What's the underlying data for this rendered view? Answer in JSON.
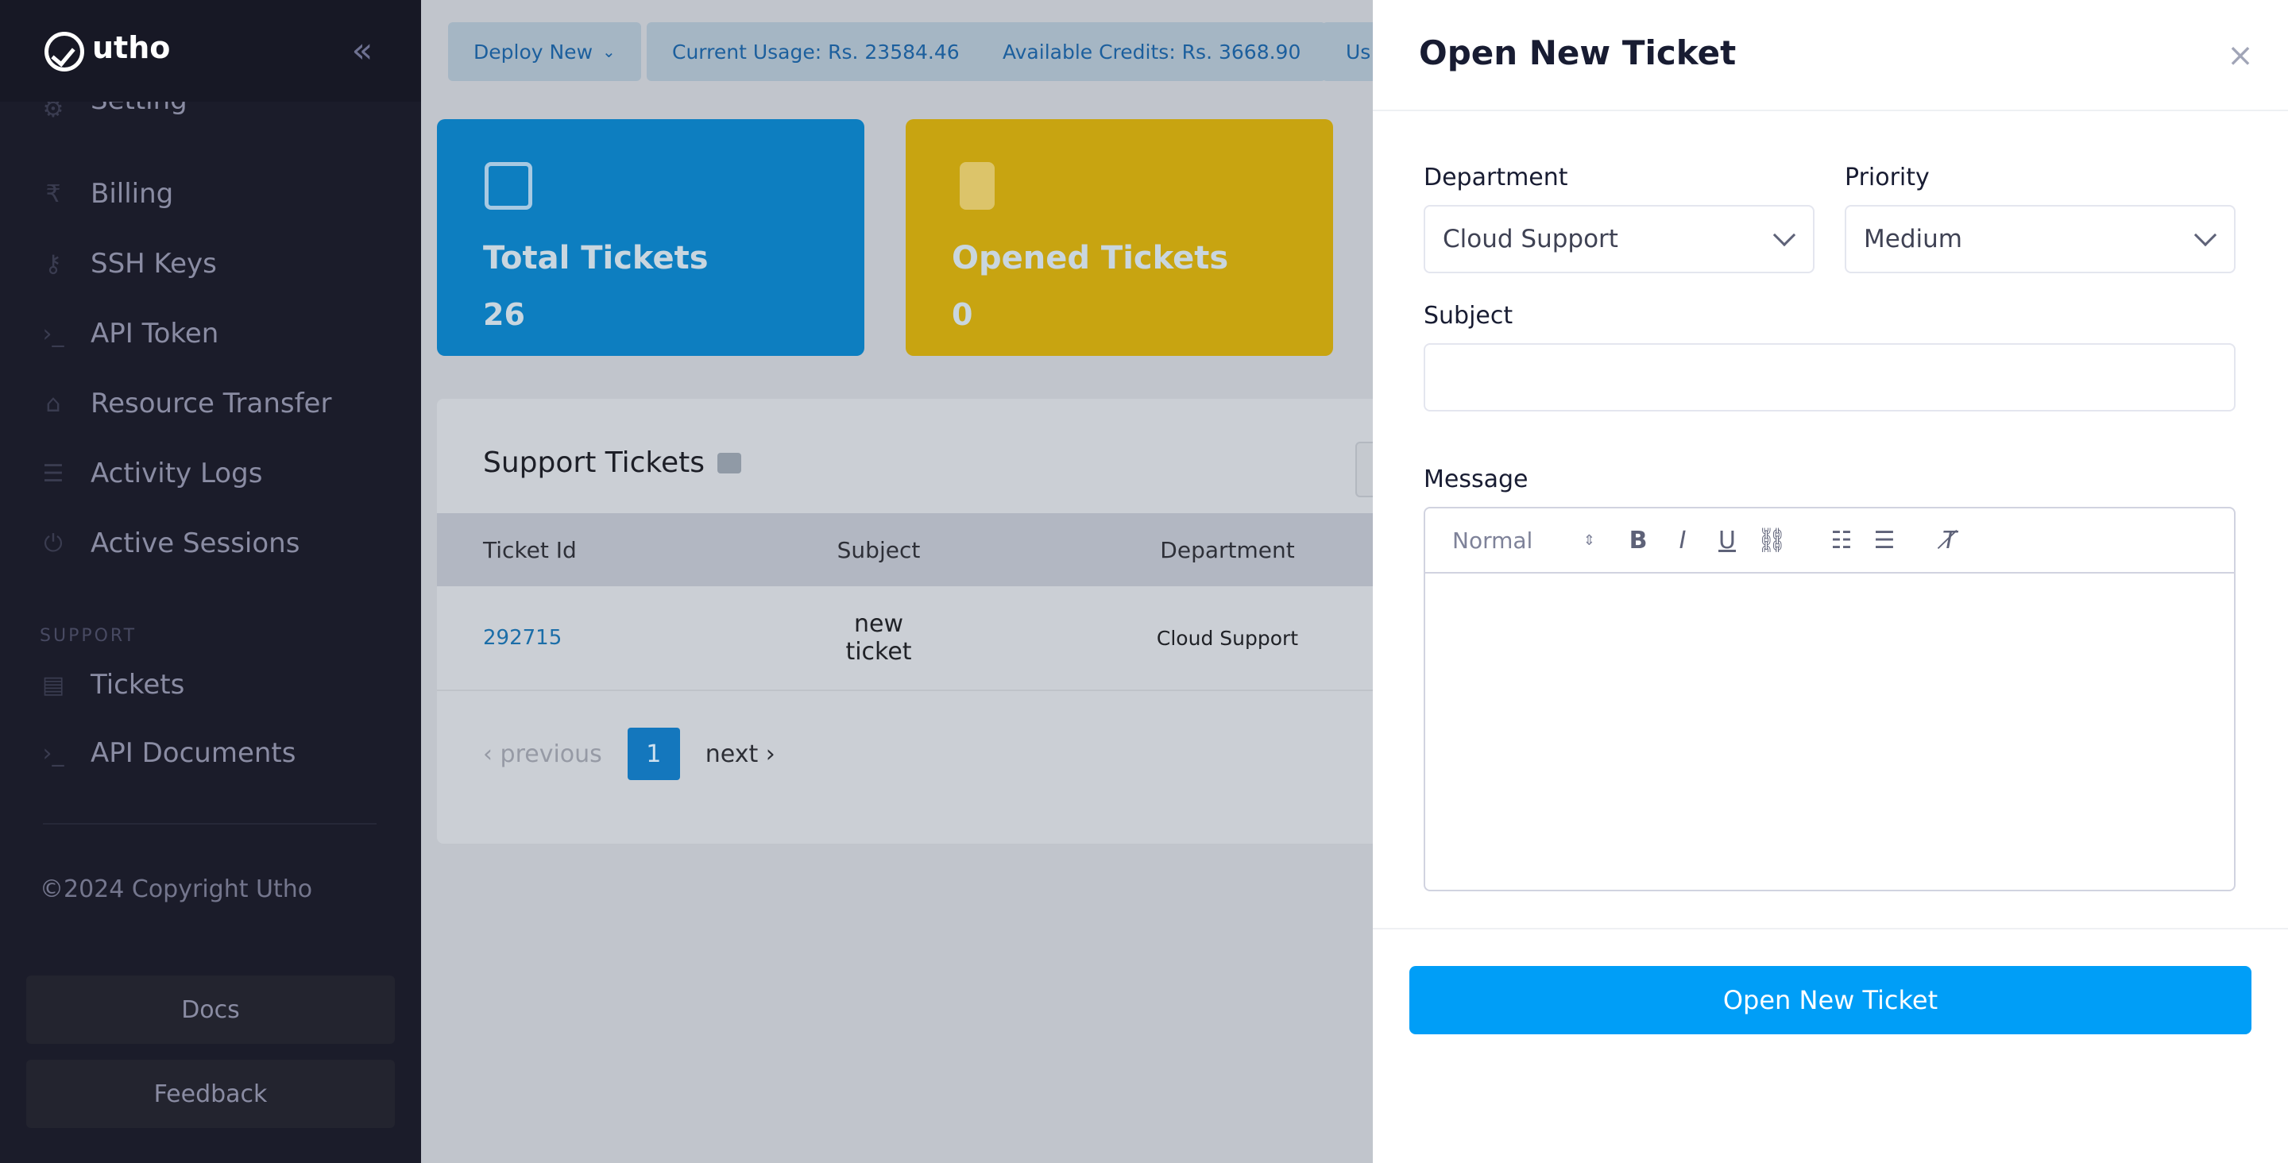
{
  "app": {
    "brand": "utho"
  },
  "sidebar": {
    "partial_item": "Setting",
    "items": [
      {
        "label": "Billing",
        "icon": "rupee-icon"
      },
      {
        "label": "SSH Keys",
        "icon": "key-icon"
      },
      {
        "label": "API Token",
        "icon": "terminal-icon"
      },
      {
        "label": "Resource Transfer",
        "icon": "transfer-icon"
      },
      {
        "label": "Activity Logs",
        "icon": "sliders-icon"
      },
      {
        "label": "Active Sessions",
        "icon": "power-icon"
      }
    ],
    "section_label": "SUPPORT",
    "support_items": [
      {
        "label": "Tickets",
        "icon": "ticket-icon"
      },
      {
        "label": "API Documents",
        "icon": "terminal-icon"
      }
    ],
    "copyright": "©2024 Copyright Utho",
    "docs_button": "Docs",
    "feedback_button": "Feedback"
  },
  "topbar": {
    "deploy": "Deploy New",
    "current_usage": "Current Usage: Rs. 23584.46",
    "available_credits": "Available Credits: Rs. 3668.90",
    "partial": "Us"
  },
  "cards": [
    {
      "title": "Total Tickets",
      "count": "26",
      "icon": "edit-icon",
      "color": "#0d7ec0"
    },
    {
      "title": "Opened Tickets",
      "count": "0",
      "icon": "refresh-file-icon",
      "color": "#c8a411"
    }
  ],
  "tickets": {
    "title": "Support Tickets",
    "columns": [
      "Ticket Id",
      "Subject",
      "Department"
    ],
    "rows": [
      {
        "id": "292715",
        "subject": "new ticket",
        "department": "Cloud Support"
      }
    ],
    "pager": {
      "prev": "‹ previous",
      "page": "1",
      "next": "next ›"
    }
  },
  "drawer": {
    "title": "Open New Ticket",
    "department": {
      "label": "Department",
      "value": "Cloud Support"
    },
    "priority": {
      "label": "Priority",
      "value": "Medium"
    },
    "subject": {
      "label": "Subject",
      "value": ""
    },
    "message": {
      "label": "Message",
      "format": "Normal"
    },
    "submit": "Open New Ticket"
  },
  "colors": {
    "accent": "#009ef7",
    "sidebar_bg": "#1b1c2a",
    "link": "#1c6ea8"
  }
}
